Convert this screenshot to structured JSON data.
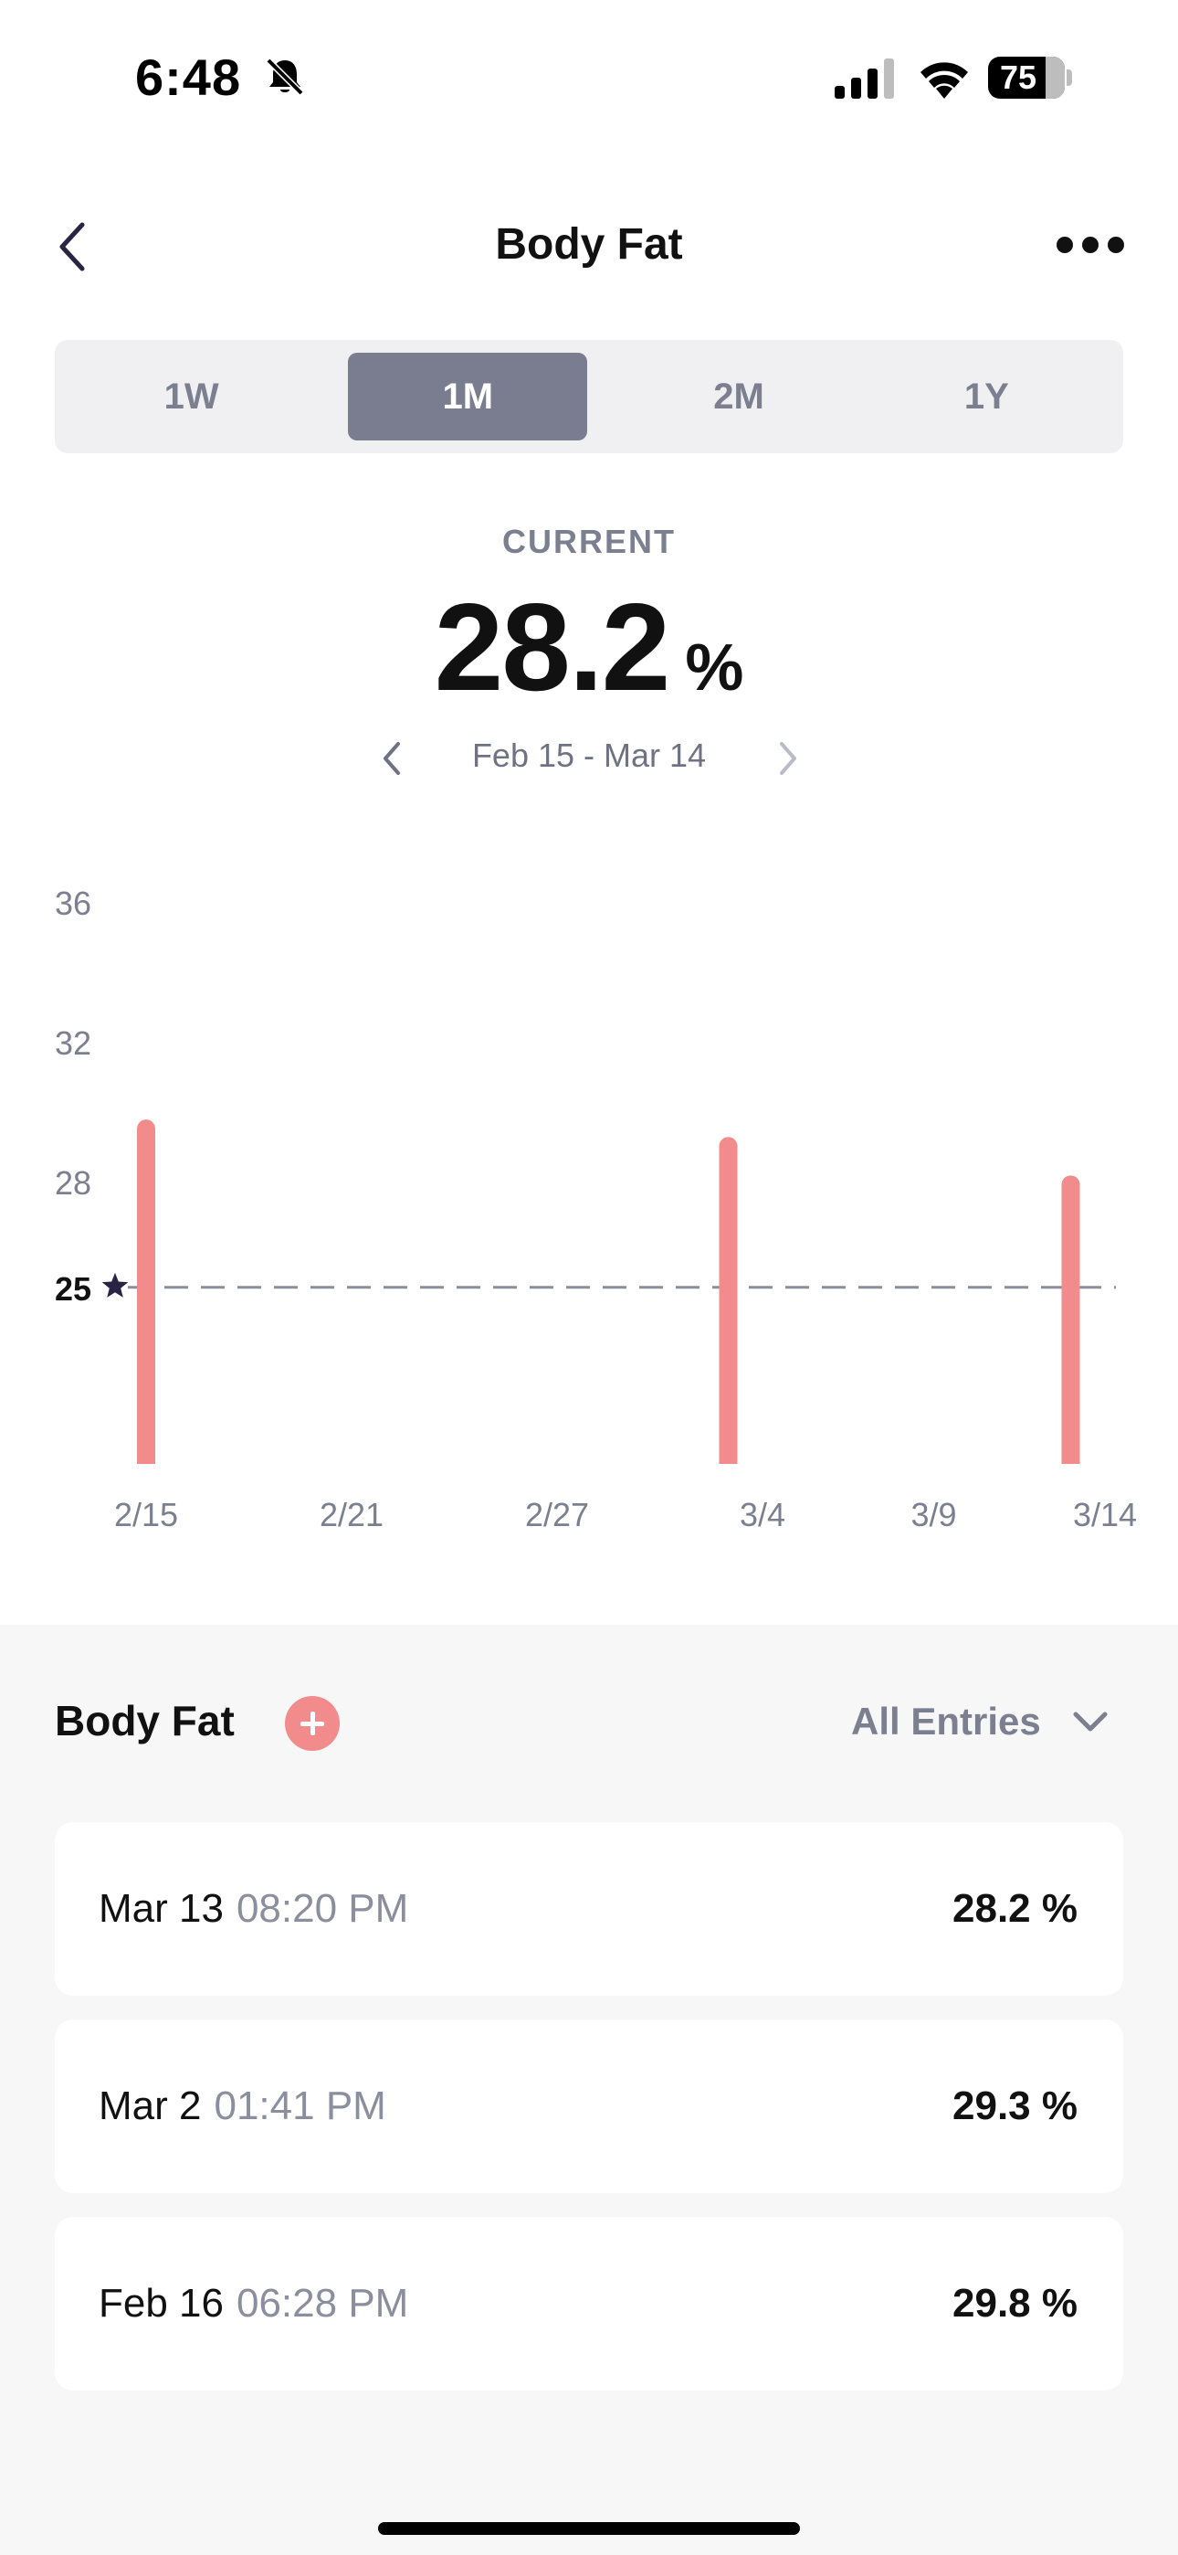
{
  "status_bar": {
    "time": "6:48",
    "battery": "75",
    "battery_level": 0.75
  },
  "header": {
    "title": "Body Fat"
  },
  "tabs": [
    {
      "label": "1W",
      "active": false
    },
    {
      "label": "1M",
      "active": true
    },
    {
      "label": "2M",
      "active": false
    },
    {
      "label": "1Y",
      "active": false
    }
  ],
  "summary": {
    "label": "CURRENT",
    "value": "28.2",
    "unit": "%",
    "range": "Feb 15 - Mar 14"
  },
  "chart_data": {
    "type": "bar",
    "x": [
      "2/15",
      "3/3",
      "3/13"
    ],
    "values": [
      29.8,
      29.3,
      28.2
    ],
    "x_ticks": [
      "2/15",
      "2/21",
      "2/27",
      "3/4",
      "3/9",
      "3/14"
    ],
    "y_ticks": [
      "36",
      "32",
      "28"
    ],
    "ylim": [
      20,
      36
    ],
    "goal": {
      "value": 25,
      "label": "25"
    },
    "bar_color": "#f28b8b",
    "goal_color": "#8a8e9d"
  },
  "entries_section": {
    "title": "Body Fat",
    "filter": "All Entries",
    "entries": [
      {
        "date": "Mar 13",
        "time": "08:20 PM",
        "value": "28.2 %"
      },
      {
        "date": "Mar 2",
        "time": "01:41 PM",
        "value": "29.3 %"
      },
      {
        "date": "Feb 16",
        "time": "06:28 PM",
        "value": "29.8 %"
      }
    ]
  },
  "colors": {
    "accent": "#f28b8b",
    "segment_active": "#7a7d8f",
    "muted_text": "#7b7f90"
  }
}
